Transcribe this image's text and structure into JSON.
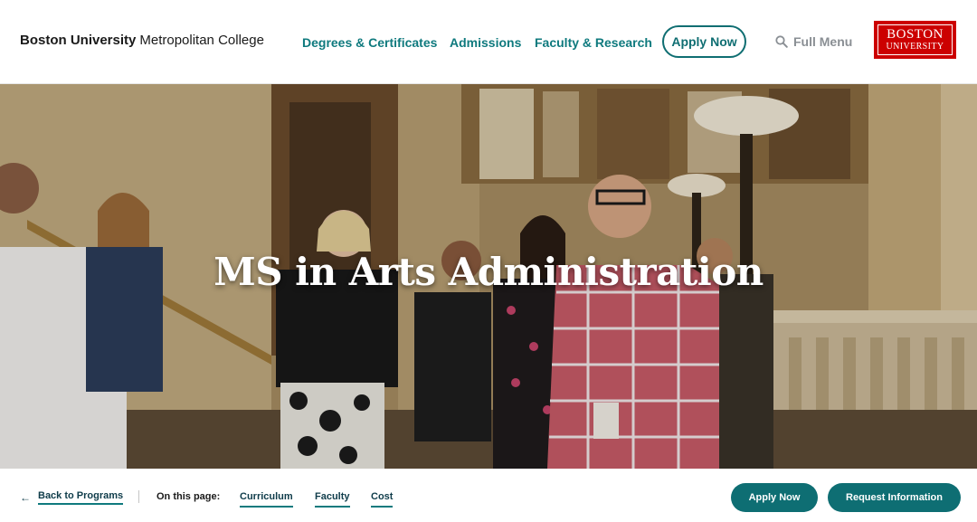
{
  "header": {
    "brand_bold": "Boston University",
    "brand_regular": "Metropolitan College",
    "nav": [
      {
        "label": "Degrees & Certificates"
      },
      {
        "label": "Admissions"
      },
      {
        "label": "Faculty & Research"
      }
    ],
    "apply_label": "Apply Now",
    "menu_label": "Full Menu",
    "logo_line1": "BOSTON",
    "logo_line2": "UNIVERSITY",
    "icons": {
      "menu": "search-icon"
    }
  },
  "hero": {
    "title": "MS in Arts Administration"
  },
  "subnav": {
    "back_label": "Back to Programs",
    "on_this_page": "On this page:",
    "anchors": [
      "Curriculum",
      "Faculty",
      "Cost"
    ],
    "apply_label": "Apply Now",
    "request_label": "Request Information"
  },
  "colors": {
    "accent": "#0f7a7e",
    "button": "#0e6e73",
    "logo_red": "#cc0000"
  }
}
